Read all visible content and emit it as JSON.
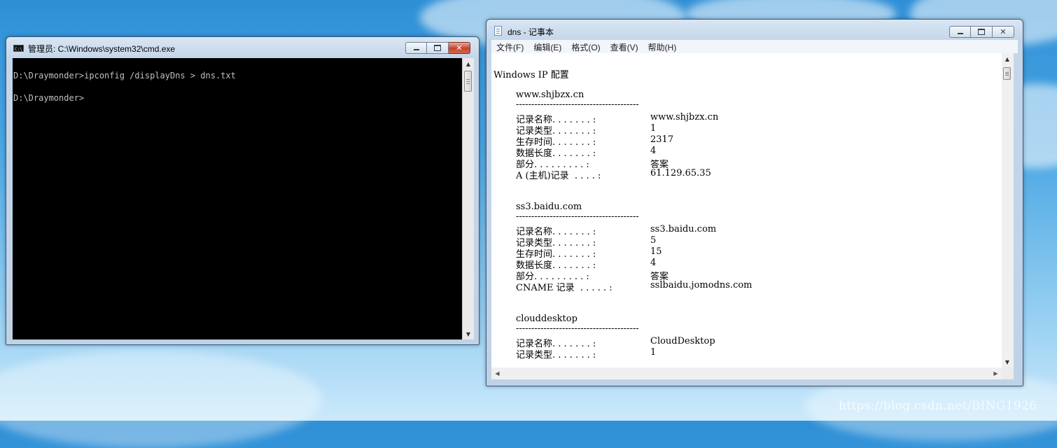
{
  "cmd_window": {
    "title": "管理员: C:\\Windows\\system32\\cmd.exe",
    "icon": "console-icon",
    "lines": [
      "D:\\Draymonder>ipconfig /displayDns > dns.txt",
      "D:\\Draymonder>"
    ]
  },
  "notepad_window": {
    "title": "dns - 记事本",
    "icon": "notepad-icon",
    "menu": [
      "文件(F)",
      "编辑(E)",
      "格式(O)",
      "查看(V)",
      "帮助(H)"
    ],
    "header": "Windows IP 配置",
    "separator": "----------------------------------------",
    "entries": [
      {
        "host": "www.shjbzx.cn",
        "fields": [
          {
            "label": "记录名称. . . . . . . :",
            "value": "www.shjbzx.cn"
          },
          {
            "label": "记录类型. . . . . . . :",
            "value": "1"
          },
          {
            "label": "生存时间. . . . . . . :",
            "value": "2317"
          },
          {
            "label": "数据长度. . . . . . . :",
            "value": "4"
          },
          {
            "label": "部分. . . . . . . . . :",
            "value": "答案"
          },
          {
            "label": "A (主机)记录  . . . . :",
            "value": "61.129.65.35"
          }
        ]
      },
      {
        "host": "ss3.baidu.com",
        "fields": [
          {
            "label": "记录名称. . . . . . . :",
            "value": "ss3.baidu.com"
          },
          {
            "label": "记录类型. . . . . . . :",
            "value": "5"
          },
          {
            "label": "生存时间. . . . . . . :",
            "value": "15"
          },
          {
            "label": "数据长度. . . . . . . :",
            "value": "4"
          },
          {
            "label": "部分. . . . . . . . . :",
            "value": "答案"
          },
          {
            "label": "CNAME 记录  . . . . . :",
            "value": "sslbaidu.jomodns.com"
          }
        ]
      },
      {
        "host": "clouddesktop",
        "fields": [
          {
            "label": "记录名称. . . . . . . :",
            "value": "CloudDesktop"
          },
          {
            "label": "记录类型. . . . . . . :",
            "value": "1"
          }
        ]
      }
    ]
  },
  "watermark": "https://blog.csdn.net/BING1926",
  "colors": {
    "console_bg": "#000000",
    "console_text": "#c0c0c0",
    "close_button_active": "#c7432c",
    "desktop_sky": "#4aa6e3"
  }
}
